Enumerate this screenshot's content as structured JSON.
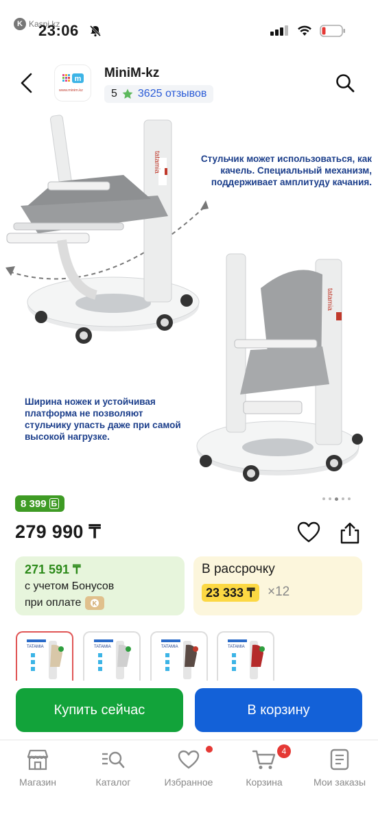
{
  "status": {
    "brand": "Kaspi.kz",
    "time": "23:06"
  },
  "header": {
    "shop_name": "MiniM-kz",
    "rating": "5",
    "reviews": "3625 отзывов",
    "logo_text": "www.minim.kz"
  },
  "hero": {
    "caption_top": "Стульчик может использоваться, как качель. Специальный механизм, поддерживает амплитуду качания.",
    "caption_bottom": "Ширина ножек и устойчивая платформа не позволяют стульчику упасть даже при самой высокой нагрузке.",
    "chair_label": "tatamia"
  },
  "product": {
    "bonus_badge": "8 399",
    "bonus_badge_unit": "Б",
    "price": "279 990 ₸",
    "bonus_card": {
      "amount": "271 591 ₸",
      "line1": "с учетом Бонусов",
      "line2": "при оплате"
    },
    "installment": {
      "title": "В рассрочку",
      "amount": "23 333 ₸",
      "multiplier": "×12"
    }
  },
  "thumbnails": [
    {
      "label": "TATAMIA",
      "seat_color": "#d8c7a8",
      "selected": true
    },
    {
      "label": "TATAMIA",
      "seat_color": "#cfcfcf",
      "selected": false
    },
    {
      "label": "TATAMIA",
      "seat_color": "#5a4a44",
      "selected": false
    },
    {
      "label": "TATAMIA",
      "seat_color": "#b52a2a",
      "selected": false
    }
  ],
  "actions": {
    "buy_now": "Купить сейчас",
    "add_to_cart": "В корзину"
  },
  "tabs": [
    {
      "label": "Магазин",
      "icon": "shop-icon"
    },
    {
      "label": "Каталог",
      "icon": "catalog-icon"
    },
    {
      "label": "Избранное",
      "icon": "heart-icon"
    },
    {
      "label": "Корзина",
      "icon": "cart-icon"
    },
    {
      "label": "Мои заказы",
      "icon": "orders-icon"
    }
  ],
  "cart_count": "4",
  "colors": {
    "green": "#12a33a",
    "blue": "#1361d8",
    "bonus_green": "#3e9b24",
    "installment_yellow": "#fcd843",
    "badge_red": "#e53935"
  }
}
